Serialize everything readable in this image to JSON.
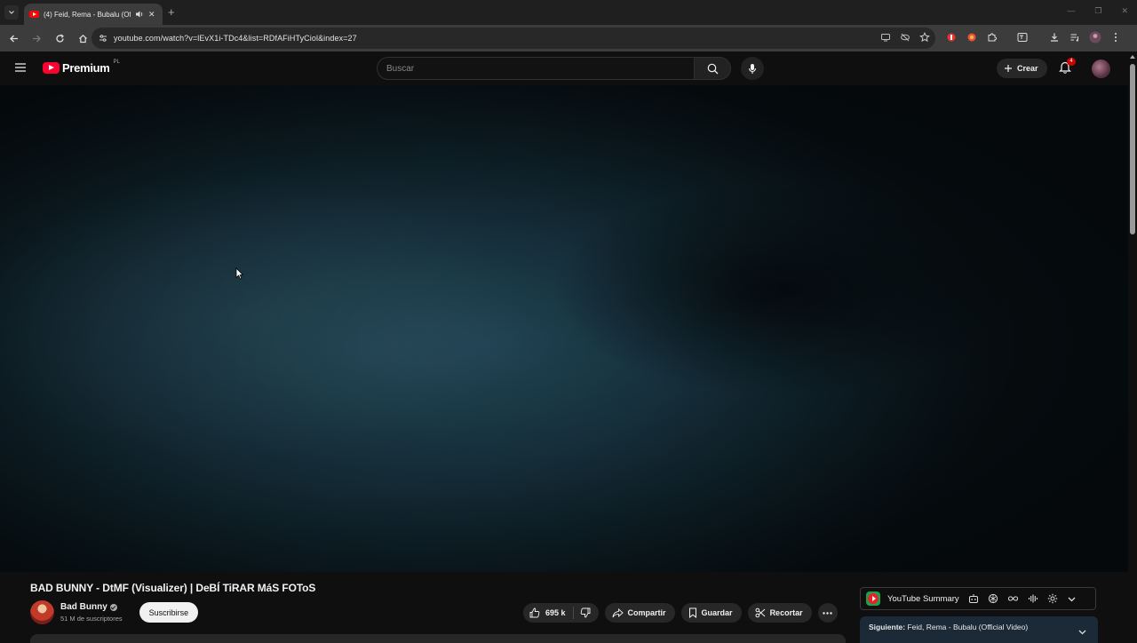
{
  "browser": {
    "tab_title": "(4) Feid, Rema - Bubalu (Offi",
    "url": "youtube.com/watch?v=lEvX1i-TDc4&list=RDfAFiHTyCiol&index=27"
  },
  "masthead": {
    "logo_text": "Premium",
    "logo_country": "PL",
    "search_placeholder": "Buscar",
    "create_label": "Crear",
    "notification_count": "4"
  },
  "video": {
    "title": "BAD BUNNY - DtMF (Visualizer) | DeBÍ TiRAR MáS FOToS",
    "channel_name": "Bad Bunny",
    "subscribers": "51 M de suscriptores",
    "subscribe_label": "Suscribirse",
    "likes": "695 k",
    "share_label": "Compartir",
    "save_label": "Guardar",
    "clip_label": "Recortar"
  },
  "side_panel": {
    "summary_title": "YouTube Summary",
    "next_label": "Siguiente:",
    "next_title": "Feid, Rema - Bubalu (Official Video)"
  },
  "colors": {
    "brand_red": "#ff0033",
    "background": "#0f0f0f",
    "chip": "#272727"
  }
}
